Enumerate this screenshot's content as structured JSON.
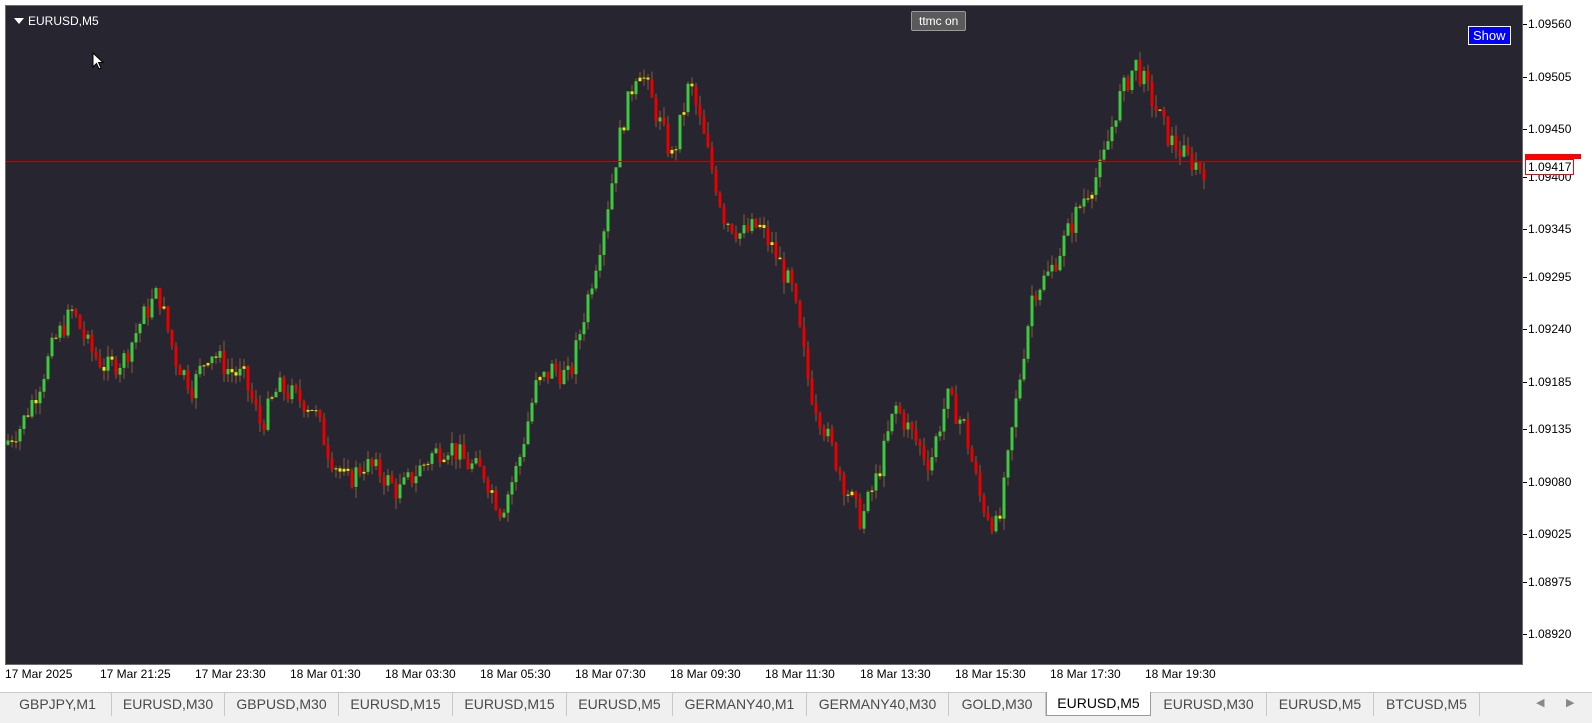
{
  "window": {
    "symbol": "EURUSD,M5"
  },
  "toolbar": {
    "ttmc_label": "ttmc on",
    "show_label": "Show"
  },
  "current_price": "1.09417",
  "colors": {
    "background": "#272530",
    "bull": "#3ec93e",
    "bear": "#e60000",
    "neutral": "#f5e600",
    "current_price_line": "#cc0000",
    "wick": "#8a5a3a"
  },
  "tabs": [
    {
      "label": "GBPJPY,M1",
      "active": false
    },
    {
      "label": "EURUSD,M30",
      "active": false
    },
    {
      "label": "GBPUSD,M30",
      "active": false
    },
    {
      "label": "EURUSD,M15",
      "active": false
    },
    {
      "label": "EURUSD,M15",
      "active": false
    },
    {
      "label": "EURUSD,M5",
      "active": false
    },
    {
      "label": "GERMANY40,M1",
      "active": false
    },
    {
      "label": "GERMANY40,M30",
      "active": false
    },
    {
      "label": "GOLD,M30",
      "active": false
    },
    {
      "label": "EURUSD,M5",
      "active": true
    },
    {
      "label": "EURUSD,M30",
      "active": false
    },
    {
      "label": "EURUSD,M5",
      "active": false
    },
    {
      "label": "BTCUSD,M5",
      "active": false
    }
  ],
  "chart_data": {
    "type": "candlestick",
    "title": "EURUSD,M5",
    "ylim": [
      1.0889,
      1.0958
    ],
    "y_ticks": [
      "1.09560",
      "1.09505",
      "1.09450",
      "1.09400",
      "1.09345",
      "1.09295",
      "1.09240",
      "1.09185",
      "1.09135",
      "1.09080",
      "1.09025",
      "1.08975",
      "1.08920"
    ],
    "x_ticks": [
      "17 Mar 2025",
      "17 Mar 21:25",
      "17 Mar 23:30",
      "18 Mar 01:30",
      "18 Mar 03:30",
      "18 Mar 05:30",
      "18 Mar 07:30",
      "18 Mar 09:30",
      "18 Mar 11:30",
      "18 Mar 13:30",
      "18 Mar 15:30",
      "18 Mar 17:30",
      "18 Mar 19:30"
    ],
    "current_price": 1.09417,
    "path": [
      1.0912,
      1.0914,
      1.0918,
      1.0923,
      1.0926,
      1.0922,
      1.092,
      1.0921,
      1.0925,
      1.0928,
      1.0921,
      1.0918,
      1.0922,
      1.092,
      1.0919,
      1.0914,
      1.0918,
      1.0917,
      1.0916,
      1.0911,
      1.0908,
      1.091,
      1.0909,
      1.0907,
      1.0909,
      1.0911,
      1.0912,
      1.091,
      1.0909,
      1.0905,
      1.091,
      1.0918,
      1.092,
      1.0919,
      1.0927,
      1.0935,
      1.0945,
      1.0952,
      1.0947,
      1.0942,
      1.095,
      1.0943,
      1.0936,
      1.0934,
      1.0935,
      1.0932,
      1.0928,
      1.0918,
      1.0913,
      1.0908,
      1.0904,
      1.0909,
      1.0916,
      1.0913,
      1.091,
      1.0917,
      1.0914,
      1.0906,
      1.0903,
      1.0916,
      1.0928,
      1.093,
      1.0934,
      1.0938,
      1.0941,
      1.0948,
      1.0952,
      1.0948,
      1.0944,
      1.0942,
      1.0941
    ]
  }
}
